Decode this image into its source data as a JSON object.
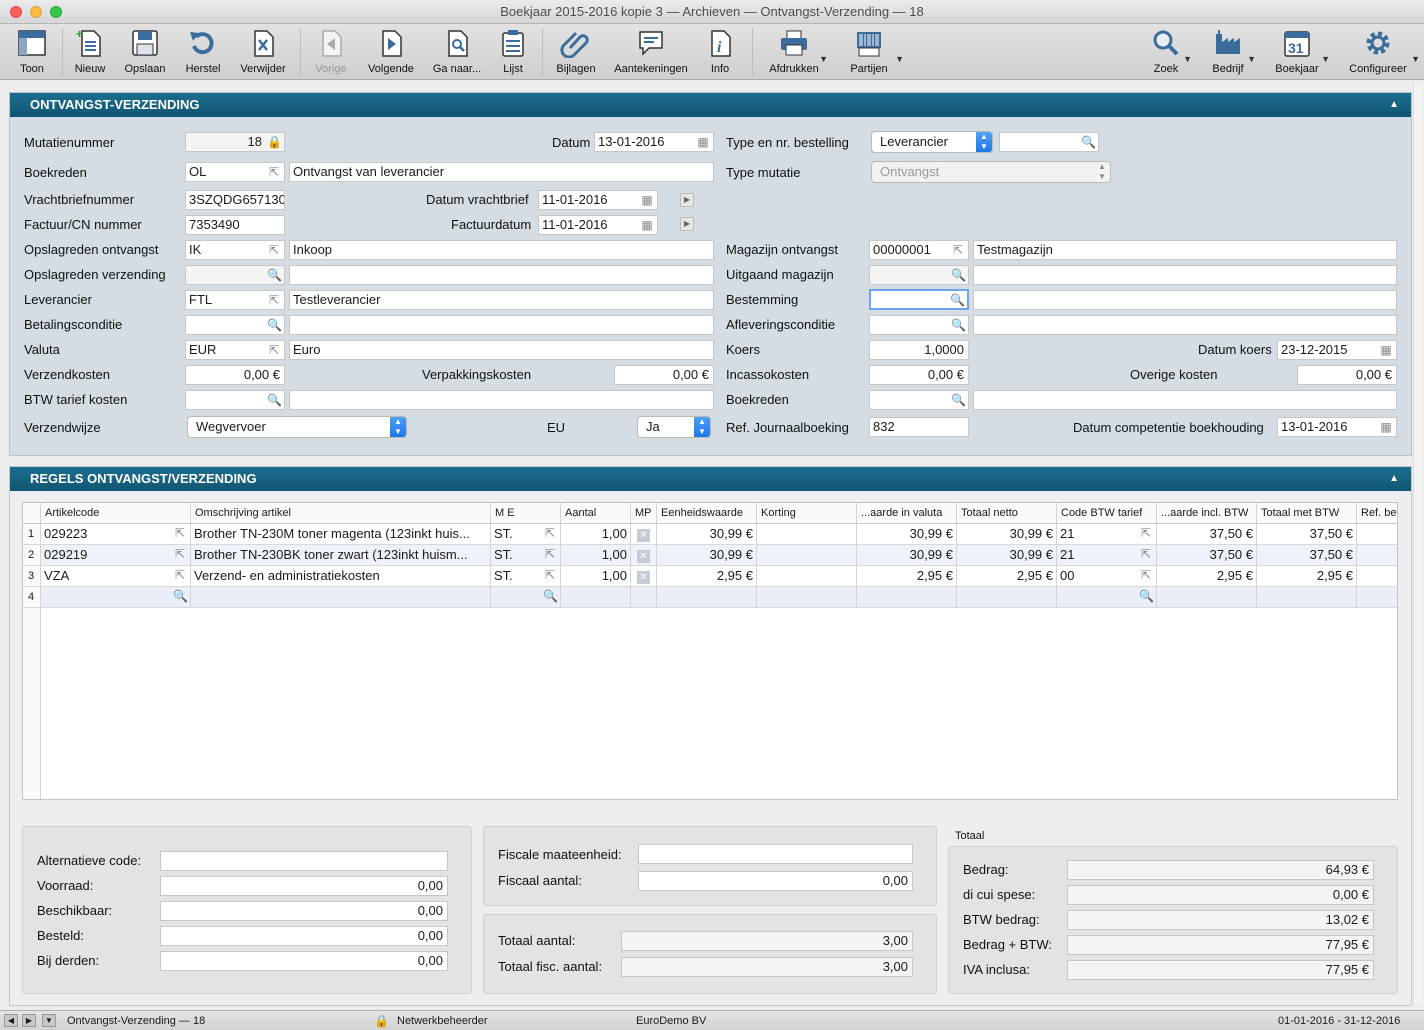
{
  "window": {
    "title": "Boekjaar 2015-2016 kopie 3 — Archieven — Ontvangst-Verzending — 18"
  },
  "toolbar": {
    "toon": "Toon",
    "nieuw": "Nieuw",
    "opslaan": "Opslaan",
    "herstel": "Herstel",
    "verwijder": "Verwijder",
    "vorige": "Vorige",
    "volgende": "Volgende",
    "ganaar": "Ga naar...",
    "lijst": "Lijst",
    "bijlagen": "Bijlagen",
    "aantekeningen": "Aantekeningen",
    "info": "Info",
    "afdrukken": "Afdrukken",
    "partijen": "Partijen",
    "zoek": "Zoek",
    "bedrijf": "Bedrijf",
    "boekjaar": "Boekjaar",
    "configureer": "Configureer",
    "boekjaar_day": "31"
  },
  "header": {
    "title": "ONTVANGST-VERZENDING"
  },
  "form": {
    "mutatienummer_label": "Mutatienummer",
    "mutatienummer": "18",
    "datum_label": "Datum",
    "datum": "13-01-2016",
    "type_bestelling_label": "Type en nr. bestelling",
    "type_bestelling": "Leverancier",
    "bestelling_nr": "",
    "boekreden_label": "Boekreden",
    "boekreden_code": "OL",
    "boekreden_desc": "Ontvangst van leverancier",
    "type_mutatie_label": "Type mutatie",
    "type_mutatie": "Ontvangst",
    "vrachtbrief_label": "Vrachtbriefnummer",
    "vrachtbrief": "3SZQDG657130",
    "datum_vrachtbrief_label": "Datum vrachtbrief",
    "datum_vrachtbrief": "11-01-2016",
    "factuur_label": "Factuur/CN nummer",
    "factuur": "7353490",
    "factuurdatum_label": "Factuurdatum",
    "factuurdatum": "11-01-2016",
    "opslag_ontv_label": "Opslagreden ontvangst",
    "opslag_ontv_code": "IK",
    "opslag_ontv_desc": "Inkoop",
    "magazijn_ontv_label": "Magazijn ontvangst",
    "magazijn_ontv_code": "00000001",
    "magazijn_ontv_desc": "Testmagazijn",
    "opslag_verz_label": "Opslagreden verzending",
    "opslag_verz_code": "",
    "opslag_verz_desc": "",
    "uitgaand_mag_label": "Uitgaand magazijn",
    "uitgaand_mag_code": "",
    "uitgaand_mag_desc": "",
    "leverancier_label": "Leverancier",
    "leverancier_code": "FTL",
    "leverancier_desc": "Testleverancier",
    "bestemming_label": "Bestemming",
    "bestemming_code": "",
    "bestemming_desc": "",
    "betaling_label": "Betalingsconditie",
    "betaling_code": "",
    "betaling_desc": "",
    "aflevering_label": "Afleveringsconditie",
    "aflevering_code": "",
    "aflevering_desc": "",
    "valuta_label": "Valuta",
    "valuta_code": "EUR",
    "valuta_desc": "Euro",
    "koers_label": "Koers",
    "koers": "1,0000",
    "datum_koers_label": "Datum koers",
    "datum_koers": "23-12-2015",
    "verzendkosten_label": "Verzendkosten",
    "verzendkosten": "0,00 €",
    "verpakking_label": "Verpakkingskosten",
    "verpakking": "0,00 €",
    "incasso_label": "Incassokosten",
    "incasso": "0,00 €",
    "overige_label": "Overige kosten",
    "overige": "0,00 €",
    "btw_tarief_label": "BTW tarief kosten",
    "btw_tarief_code": "",
    "btw_tarief_desc": "",
    "boekreden2_label": "Boekreden",
    "boekreden2_code": "",
    "boekreden2_desc": "",
    "verzendwijze_label": "Verzendwijze",
    "verzendwijze": "Wegvervoer",
    "eu_label": "EU",
    "eu": "Ja",
    "ref_journaal_label": "Ref. Journaalboeking",
    "ref_journaal": "832",
    "datum_comp_label": "Datum competentie boekhouding",
    "datum_comp": "13-01-2016"
  },
  "lines": {
    "title": "REGELS ONTVANGST/VERZENDING",
    "columns": {
      "artikelcode": "Artikelcode",
      "omschrijving": "Omschrijving artikel",
      "me": "M E",
      "aantal": "Aantal",
      "mp": "MP",
      "eenheid": "Eenheidswaarde",
      "korting": "Korting",
      "valuta": "...aarde in valuta",
      "netto": "Totaal netto",
      "btw_code": "Code BTW tarief",
      "incl": "...aarde incl. BTW",
      "met_btw": "Totaal met BTW",
      "ref": "Ref. be"
    },
    "rows": [
      {
        "n": "1",
        "code": "029223",
        "desc": "Brother TN-230M toner magenta (123inkt huis...",
        "me": "ST.",
        "aantal": "1,00",
        "eenheid": "30,99 €",
        "korting": "",
        "valuta": "30,99 €",
        "netto": "30,99 €",
        "btw": "21",
        "incl": "37,50 €",
        "met": "37,50 €"
      },
      {
        "n": "2",
        "code": "029219",
        "desc": "Brother TN-230BK toner zwart (123inkt huism...",
        "me": "ST.",
        "aantal": "1,00",
        "eenheid": "30,99 €",
        "korting": "",
        "valuta": "30,99 €",
        "netto": "30,99 €",
        "btw": "21",
        "incl": "37,50 €",
        "met": "37,50 €"
      },
      {
        "n": "3",
        "code": "VZA",
        "desc": "Verzend- en administratiekosten",
        "me": "ST.",
        "aantal": "1,00",
        "eenheid": "2,95 €",
        "korting": "",
        "valuta": "2,95 €",
        "netto": "2,95 €",
        "btw": "00",
        "incl": "2,95 €",
        "met": "2,95 €"
      }
    ],
    "new_row": "4"
  },
  "info": {
    "alt_label": "Alternatieve code:",
    "alt": "",
    "voorraad_label": "Voorraad:",
    "voorraad": "0,00",
    "beschikbaar_label": "Beschikbaar:",
    "beschikbaar": "0,00",
    "besteld_label": "Besteld:",
    "besteld": "0,00",
    "derden_label": "Bij derden:",
    "derden": "0,00"
  },
  "fiscal": {
    "maat_label": "Fiscale maateenheid:",
    "maat": "",
    "aantal_label": "Fiscaal aantal:",
    "aantal": "0,00",
    "tot_aantal_label": "Totaal aantal:",
    "tot_aantal": "3,00",
    "tot_fisc_label": "Totaal fisc. aantal:",
    "tot_fisc": "3,00"
  },
  "totaal": {
    "title": "Totaal",
    "bedrag_label": "Bedrag:",
    "bedrag": "64,93 €",
    "spese_label": "di cui spese:",
    "spese": "0,00 €",
    "btw_label": "BTW bedrag:",
    "btw": "13,02 €",
    "bedrag_btw_label": "Bedrag + BTW:",
    "bedrag_btw": "77,95 €",
    "iva_label": "IVA inclusa:",
    "iva": "77,95 €"
  },
  "status": {
    "record": "Ontvangst-Verzending — 18",
    "user": "Netwerkbeheerder",
    "company": "EuroDemo BV",
    "period": "01-01-2016 - 31-12-2016"
  },
  "colors": {
    "accent": "#115673",
    "panel": "#d3dde3"
  }
}
